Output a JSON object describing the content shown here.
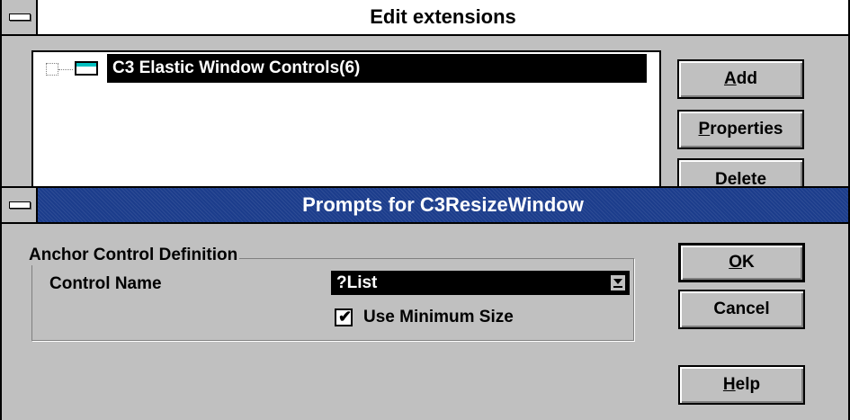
{
  "edit_window": {
    "title": "Edit extensions",
    "tree_item_label": "C3 Elastic Window Controls(6)",
    "buttons": {
      "add": {
        "mnemonic": "A",
        "rest": "dd"
      },
      "properties": {
        "mnemonic": "P",
        "rest": "roperties"
      },
      "delete": {
        "label": "Delete"
      }
    }
  },
  "prompt_window": {
    "title": "Prompts for C3ResizeWindow",
    "group_label": "Anchor Control Definition",
    "control_name_label": "Control Name",
    "control_name_value": "?List",
    "use_min_size_label": "Use Minimum Size",
    "use_min_size_checked": true,
    "checkmark": "✔",
    "buttons": {
      "ok": {
        "mnemonic": "O",
        "rest": "K"
      },
      "cancel": {
        "label": "Cancel"
      },
      "help": {
        "mnemonic": "H",
        "rest": "elp"
      }
    }
  },
  "colors": {
    "active_title": "#1c3d8c",
    "selection": "#000000",
    "face": "#c0c0c0"
  }
}
